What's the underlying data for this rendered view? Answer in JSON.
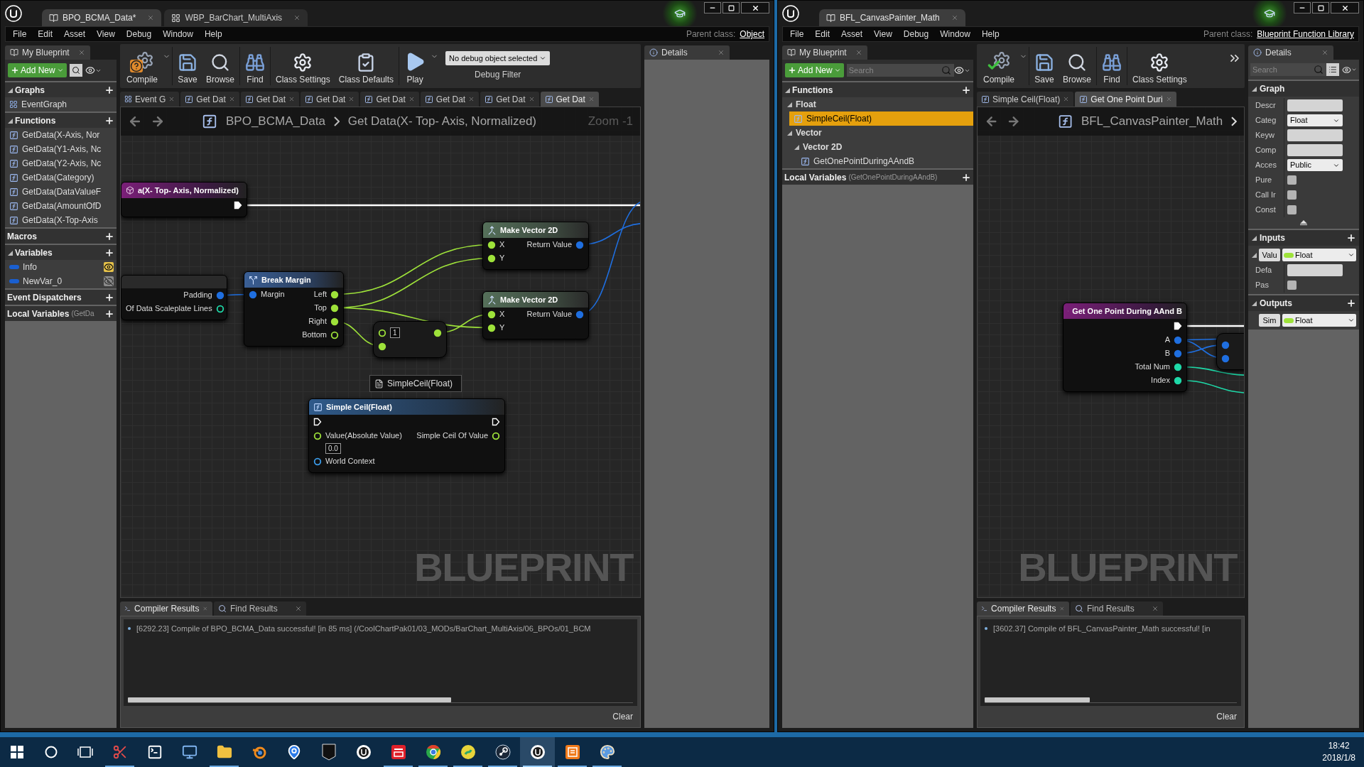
{
  "editors": [
    {
      "asset_tabs": [
        {
          "label": "BPO_BCMA_Data*",
          "kind": "blueprint",
          "selected": true
        },
        {
          "label": "WBP_BarChart_MultiAxis",
          "kind": "widget",
          "selected": false
        }
      ],
      "menu": [
        "File",
        "Edit",
        "Asset",
        "View",
        "Debug",
        "Window",
        "Help"
      ],
      "parent_class": {
        "label": "Parent class:",
        "value": "Object"
      },
      "my_blueprint": {
        "title": "My Blueprint",
        "add_new": "Add New",
        "sections": [
          {
            "title": "Graphs",
            "expanded": true,
            "add": true,
            "items": [
              {
                "label": "EventGraph",
                "kind": "graph",
                "selected": false
              }
            ]
          },
          {
            "title": "Functions",
            "expanded": true,
            "add": true,
            "items": [
              {
                "label": "GetData(X-Axis, Nor",
                "kind": "function",
                "selected": false
              },
              {
                "label": "GetData(Y1-Axis, Nc",
                "kind": "function",
                "selected": false
              },
              {
                "label": "GetData(Y2-Axis, Nc",
                "kind": "function",
                "selected": false
              },
              {
                "label": "GetData(Category)",
                "kind": "function",
                "selected": false
              },
              {
                "label": "GetData(DataValueF",
                "kind": "function",
                "selected": false
              },
              {
                "label": "GetData(AmountOfD",
                "kind": "function",
                "selected": false
              },
              {
                "label": "GetData(X-Top-Axis",
                "kind": "function",
                "selected": false
              }
            ]
          },
          {
            "title": "Macros",
            "add": true
          },
          {
            "title": "Variables",
            "expanded": true,
            "add": true,
            "items": [
              {
                "label": "Info",
                "kind": "variable",
                "public": true,
                "selected": false
              },
              {
                "label": "NewVar_0",
                "kind": "variable",
                "public": false,
                "selected": false
              }
            ]
          },
          {
            "title": "Event Dispatchers",
            "add": true
          },
          {
            "title": "Local Variables",
            "note": "(GetDa",
            "add": true
          }
        ]
      },
      "toolbar": {
        "buttons": [
          {
            "label": "Compile",
            "kind": "compile",
            "needs_compile": true,
            "menu": true
          },
          {
            "label": "Save",
            "kind": "save"
          },
          {
            "label": "Browse",
            "kind": "browse"
          },
          {
            "label": "Find",
            "kind": "find"
          },
          {
            "label": "Class Settings",
            "kind": "class_settings"
          },
          {
            "label": "Class Defaults",
            "kind": "class_defaults"
          },
          {
            "label": "Play",
            "kind": "play",
            "menu": true
          }
        ],
        "debug_filter": {
          "value": "No debug object selected",
          "label": "Debug Filter"
        },
        "overflow": false
      },
      "doc_tabs": [
        {
          "label": "Event G",
          "kind": "graph",
          "selected": false
        },
        {
          "label": "Get Dat",
          "kind": "function",
          "selected": false
        },
        {
          "label": "Get Dat",
          "kind": "function",
          "selected": false
        },
        {
          "label": "Get Dat",
          "kind": "function",
          "selected": false
        },
        {
          "label": "Get Dat",
          "kind": "function",
          "selected": false
        },
        {
          "label": "Get Dat",
          "kind": "function",
          "selected": false
        },
        {
          "label": "Get Dat",
          "kind": "function",
          "selected": false
        },
        {
          "label": "Get Dat",
          "kind": "function",
          "selected": true
        }
      ],
      "breadcrumb": {
        "path": [
          "BPO_BCMA_Data",
          "Get Data(X- Top- Axis, Normalized)"
        ],
        "zoom": "Zoom -1",
        "more": false
      },
      "graph": {
        "watermark": "BLUEPRINT",
        "nodes": [
          {
            "kind": "event",
            "title": "a(X- Top- Axis, Normalized)",
            "exec_out": {
              "connected": true
            }
          },
          {
            "kind": "variable",
            "outputs": [
              {
                "label": "Padding",
                "kind": "struct",
                "connected": true
              },
              {
                "label": "Of Data Scaleplate Lines",
                "kind": "int",
                "connected": false
              }
            ]
          },
          {
            "kind": "break",
            "title": "Break Margin",
            "inputs": [
              {
                "label": "Margin",
                "kind": "struct",
                "connected": true
              }
            ],
            "outputs": [
              {
                "label": "Left",
                "kind": "float",
                "connected": true
              },
              {
                "label": "Top",
                "kind": "float",
                "connected": true
              },
              {
                "label": "Right",
                "kind": "float",
                "connected": true
              },
              {
                "label": "Bottom",
                "kind": "float",
                "connected": false
              }
            ]
          },
          {
            "kind": "pure",
            "title": "Make Vector 2D",
            "inputs": [
              {
                "label": "X",
                "kind": "float",
                "connected": true
              },
              {
                "label": "Y",
                "kind": "float",
                "connected": true
              }
            ],
            "outputs": [
              {
                "label": "Return Value",
                "kind": "struct",
                "connected": true
              }
            ]
          },
          {
            "kind": "pure",
            "title": "Make Vector 2D",
            "inputs": [
              {
                "label": "X",
                "kind": "float",
                "connected": true
              },
              {
                "label": "Y",
                "kind": "float",
                "connected": true
              }
            ],
            "outputs": [
              {
                "label": "Return Value",
                "kind": "struct",
                "connected": true
              }
            ]
          },
          {
            "kind": "operator",
            "inputs": [
              {
                "kind": "float",
                "connected": false,
                "default": "1"
              },
              {
                "kind": "float",
                "connected": true
              }
            ],
            "outputs": [
              {
                "kind": "float",
                "connected": true
              }
            ]
          },
          {
            "kind": "label",
            "title": "SimpleCeil(Float)"
          },
          {
            "kind": "function",
            "title": "Simple Ceil(Float)",
            "exec_in": {
              "connected": false
            },
            "exec_out": {
              "connected": false
            },
            "inputs": [
              {
                "label": "Value(Absolute Value)",
                "kind": "float",
                "connected": false,
                "default": "0.0"
              },
              {
                "label": "World Context",
                "kind": "object",
                "connected": false
              }
            ],
            "outputs": [
              {
                "label": "Simple Ceil Of Value",
                "kind": "float",
                "connected": false
              }
            ]
          }
        ]
      },
      "details": {
        "title": "Details"
      },
      "results": {
        "tabs": [
          {
            "label": "Compiler Results",
            "kind": "compiler",
            "selected": true
          },
          {
            "label": "Find Results",
            "kind": "find",
            "selected": false
          }
        ],
        "messages": [
          "[6292.23] Compile of BPO_BCMA_Data successful! [in 85 ms] (/CoolChartPak01/03_MODs/BarChart_MultiAxis/06_BPOs/01_BCM"
        ],
        "clear": "Clear"
      }
    },
    {
      "asset_tabs": [
        {
          "label": "BFL_CanvasPainter_Math",
          "kind": "blueprint",
          "selected": true
        }
      ],
      "menu": [
        "File",
        "Edit",
        "Asset",
        "View",
        "Debug",
        "Window",
        "Help"
      ],
      "parent_class": {
        "label": "Parent class:",
        "value": "Blueprint Function Library"
      },
      "my_blueprint": {
        "title": "My Blueprint",
        "add_new": "Add New",
        "search_placeholder": "Search",
        "sections": [
          {
            "title": "Functions",
            "expanded": true,
            "add": true,
            "items": [
              {
                "label": "Float",
                "kind": "category",
                "expanded": true,
                "children": [
                  {
                    "label": "SimpleCeil(Float)",
                    "kind": "function",
                    "selected": true
                  }
                ]
              },
              {
                "label": "Vector",
                "kind": "category",
                "expanded": true,
                "children": [
                  {
                    "label": "Vector 2D",
                    "kind": "category",
                    "expanded": true,
                    "children": [
                      {
                        "label": "GetOnePointDuringAAndB",
                        "kind": "function",
                        "selected": false
                      }
                    ]
                  }
                ]
              }
            ]
          },
          {
            "title": "Local Variables",
            "note": "(GetOnePointDuringAAndB)",
            "add": true
          }
        ]
      },
      "toolbar": {
        "buttons": [
          {
            "label": "Compile",
            "kind": "compile",
            "needs_compile": false,
            "menu": true
          },
          {
            "label": "Save",
            "kind": "save"
          },
          {
            "label": "Browse",
            "kind": "browse"
          },
          {
            "label": "Find",
            "kind": "find"
          },
          {
            "label": "Class Settings",
            "kind": "class_settings"
          }
        ],
        "overflow": true
      },
      "doc_tabs": [
        {
          "label": "Simple Ceil(Float)",
          "kind": "function",
          "selected": false
        },
        {
          "label": "Get One Point Duri",
          "kind": "function",
          "selected": true
        }
      ],
      "breadcrumb": {
        "path": [
          "BFL_CanvasPainter_Math"
        ],
        "more": true
      },
      "graph": {
        "watermark": "BLUEPRINT",
        "nodes": [
          {
            "kind": "event",
            "title": "Get One Point During AAnd B",
            "exec_out": {
              "connected": true
            },
            "outputs": [
              {
                "label": "A",
                "kind": "struct",
                "connected": true
              },
              {
                "label": "B",
                "kind": "struct",
                "connected": true
              },
              {
                "label": "Total Num",
                "kind": "int",
                "connected": true
              },
              {
                "label": "Index",
                "kind": "int",
                "connected": true
              }
            ]
          },
          {
            "kind": "operator",
            "inputs": [
              {
                "kind": "struct",
                "connected": true
              },
              {
                "kind": "struct",
                "connected": true
              }
            ]
          }
        ]
      },
      "details": {
        "title": "Details",
        "search_placeholder": "Search",
        "sections": [
          {
            "title": "Graph",
            "expanded": true,
            "rows": [
              {
                "label": "Descr",
                "kind": "text"
              },
              {
                "label": "Categ",
                "kind": "select",
                "value": "Float"
              },
              {
                "label": "Keyw",
                "kind": "text"
              },
              {
                "label": "Comp",
                "kind": "text"
              },
              {
                "label": "Acces",
                "kind": "select",
                "value": "Public"
              },
              {
                "label": "Pure",
                "kind": "checkbox",
                "checked": false
              },
              {
                "label": "Call Ir",
                "kind": "checkbox",
                "checked": false
              },
              {
                "label": "Const",
                "kind": "checkbox",
                "checked": false
              }
            ]
          },
          {
            "title": "Inputs",
            "expanded": true,
            "add": true,
            "params": [
              {
                "name": "Valu",
                "type": "Float",
                "expanded": true,
                "rows": [
                  {
                    "label": "Defa",
                    "kind": "text"
                  },
                  {
                    "label": "Pas",
                    "kind": "checkbox",
                    "checked": false
                  }
                ]
              }
            ]
          },
          {
            "title": "Outputs",
            "expanded": true,
            "add": true,
            "params": [
              {
                "name": "Sim",
                "type": "Float"
              }
            ]
          }
        ]
      },
      "results": {
        "tabs": [
          {
            "label": "Compiler Results",
            "kind": "compiler",
            "selected": true
          },
          {
            "label": "Find Results",
            "kind": "find",
            "selected": false
          }
        ],
        "messages": [
          "[3602.37] Compile of BFL_CanvasPainter_Math successful! [in"
        ],
        "clear": "Clear"
      }
    }
  ],
  "taskbar": {
    "apps": [
      {
        "kind": "snipping",
        "running": true,
        "selected": false
      },
      {
        "kind": "terminal",
        "running": false,
        "selected": false
      },
      {
        "kind": "network",
        "running": false,
        "selected": false
      },
      {
        "kind": "explorer",
        "running": true,
        "selected": false
      },
      {
        "kind": "blender",
        "running": false,
        "selected": false
      },
      {
        "kind": "maps",
        "running": false,
        "selected": false
      },
      {
        "kind": "epic",
        "running": false,
        "selected": false
      },
      {
        "kind": "unreal",
        "running": false,
        "selected": false
      },
      {
        "kind": "youdao",
        "running": true,
        "selected": false
      },
      {
        "kind": "chrome",
        "running": true,
        "selected": false
      },
      {
        "kind": "music",
        "running": true,
        "selected": false
      },
      {
        "kind": "steam",
        "running": true,
        "selected": false
      },
      {
        "kind": "unreal",
        "running": true,
        "selected": true
      },
      {
        "kind": "notes",
        "running": true,
        "selected": false
      },
      {
        "kind": "paint",
        "running": true,
        "selected": false
      }
    ],
    "clock": {
      "time": "18:42",
      "date": "2018/1/8"
    }
  }
}
